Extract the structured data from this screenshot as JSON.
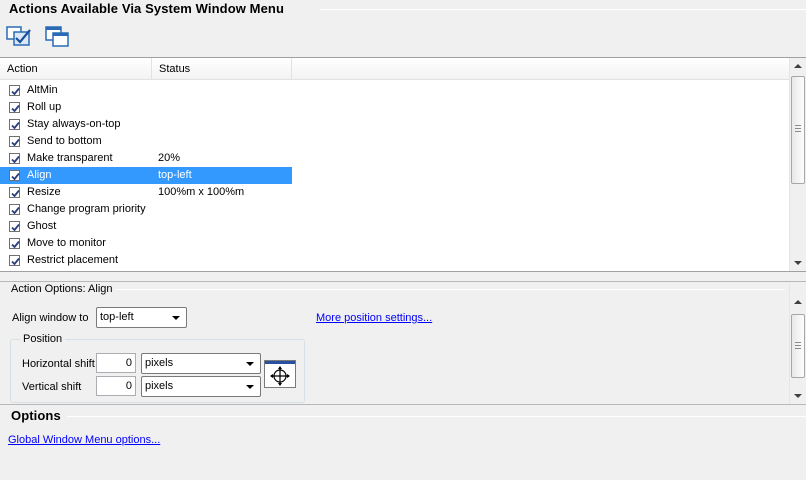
{
  "header": {
    "title": "Actions Available Via System Window Menu",
    "toolbar": [
      {
        "name": "check-all-icon"
      },
      {
        "name": "windows-icon"
      }
    ]
  },
  "actions_list": {
    "columns": [
      "Action",
      "Status"
    ],
    "rows": [
      {
        "action": "AltMin",
        "status": "",
        "checked": true,
        "selected": false
      },
      {
        "action": "Roll up",
        "status": "",
        "checked": true,
        "selected": false
      },
      {
        "action": "Stay always-on-top",
        "status": "",
        "checked": true,
        "selected": false
      },
      {
        "action": "Send to bottom",
        "status": "",
        "checked": true,
        "selected": false
      },
      {
        "action": "Make transparent",
        "status": "20%",
        "checked": true,
        "selected": false
      },
      {
        "action": "Align",
        "status": "top-left",
        "checked": true,
        "selected": true
      },
      {
        "action": "Resize",
        "status": "100%m x 100%m",
        "checked": true,
        "selected": false
      },
      {
        "action": "Change program priority",
        "status": "",
        "checked": true,
        "selected": false
      },
      {
        "action": "Ghost",
        "status": "",
        "checked": true,
        "selected": false
      },
      {
        "action": "Move to monitor",
        "status": "",
        "checked": true,
        "selected": false
      },
      {
        "action": "Restrict placement",
        "status": "",
        "checked": true,
        "selected": false
      }
    ]
  },
  "action_options": {
    "title": "Action Options: Align",
    "align_label": "Align window to",
    "align_value": "top-left",
    "more_link": "More position settings...",
    "position_group": "Position",
    "horizontal_label": "Horizontal shift",
    "horizontal_value": "0",
    "horizontal_unit": "pixels",
    "vertical_label": "Vertical shift",
    "vertical_value": "0",
    "vertical_unit": "pixels"
  },
  "options": {
    "title": "Options",
    "global_link": "Global Window Menu options..."
  },
  "colors": {
    "selection": "#3399ff",
    "link": "#0000ff",
    "background": "#f0f0f0"
  }
}
